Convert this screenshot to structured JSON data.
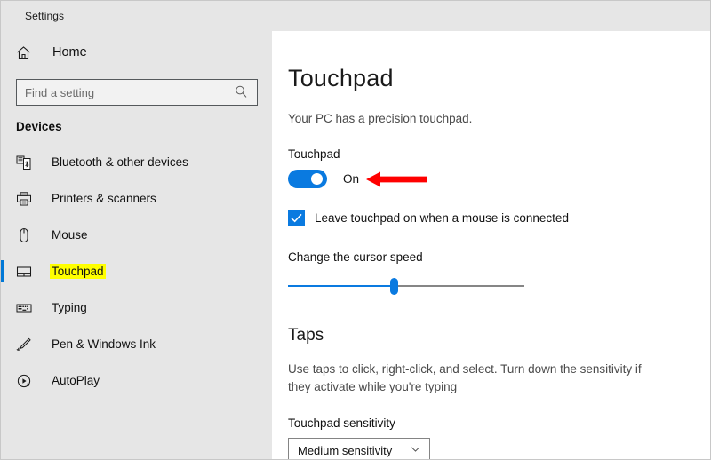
{
  "window": {
    "app_title": "Settings"
  },
  "sidebar": {
    "home": {
      "label": "Home",
      "icon": "home-icon"
    },
    "search": {
      "placeholder": "Find a setting",
      "value": "",
      "icon": "search-icon"
    },
    "section_heading": "Devices",
    "items": [
      {
        "label": "Bluetooth & other devices",
        "icon": "bluetooth-devices-icon",
        "selected": false
      },
      {
        "label": "Printers & scanners",
        "icon": "printer-icon",
        "selected": false
      },
      {
        "label": "Mouse",
        "icon": "mouse-icon",
        "selected": false
      },
      {
        "label": "Touchpad",
        "icon": "touchpad-icon",
        "selected": true
      },
      {
        "label": "Typing",
        "icon": "keyboard-icon",
        "selected": false
      },
      {
        "label": "Pen & Windows Ink",
        "icon": "pen-icon",
        "selected": false
      },
      {
        "label": "AutoPlay",
        "icon": "autoplay-icon",
        "selected": false
      }
    ],
    "selected_highlight_color": "#ffff00",
    "selection_bar_color": "#0078d7"
  },
  "main": {
    "title": "Touchpad",
    "subtitle": "Your PC has a precision touchpad.",
    "touchpad_toggle": {
      "label": "Touchpad",
      "state": "On",
      "enabled": true,
      "accent_color": "#0a7ae0"
    },
    "annotation_arrow": {
      "color": "#ff0000",
      "direction": "left",
      "points_at": "touchpad-toggle"
    },
    "leave_on_checkbox": {
      "label": "Leave touchpad on when a mouse is connected",
      "checked": true
    },
    "cursor_speed": {
      "label": "Change the cursor speed",
      "value_percent": 45
    },
    "taps_section": {
      "title": "Taps",
      "description": "Use taps to click, right-click, and select. Turn down the sensitivity if they activate while you're typing",
      "sensitivity_label": "Touchpad sensitivity",
      "sensitivity_value": "Medium sensitivity"
    }
  }
}
